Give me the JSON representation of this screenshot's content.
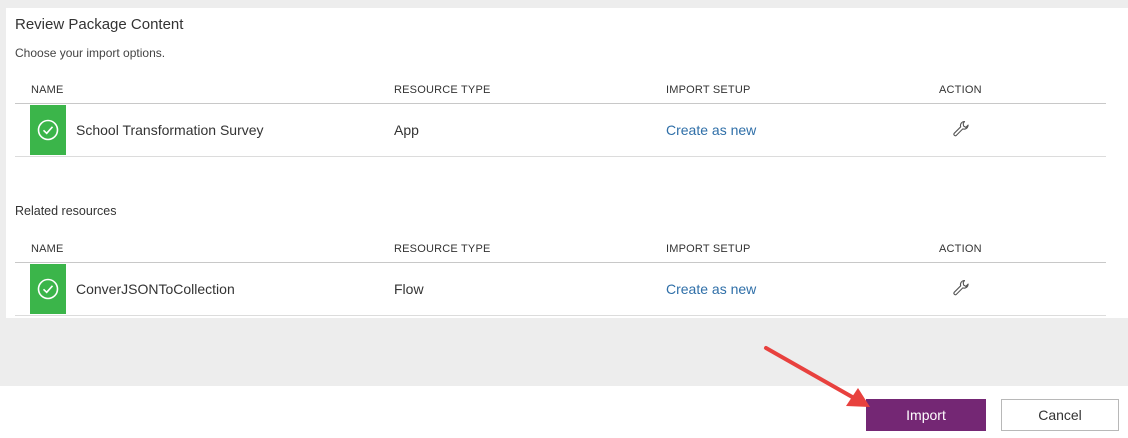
{
  "title": "Review Package Content",
  "subtitle": "Choose your import options.",
  "columns": {
    "name": "NAME",
    "resource_type": "RESOURCE TYPE",
    "import_setup": "IMPORT SETUP",
    "action": "ACTION"
  },
  "main_rows": [
    {
      "status": "ok",
      "name": "School Transformation Survey",
      "resource_type": "App",
      "import_setup": "Create as new",
      "action_icon": "wrench-icon"
    }
  ],
  "related": {
    "label": "Related resources",
    "rows": [
      {
        "status": "ok",
        "name": "ConverJSONToCollection",
        "resource_type": "Flow",
        "import_setup": "Create as new",
        "action_icon": "wrench-icon"
      }
    ]
  },
  "buttons": {
    "import": "Import",
    "cancel": "Cancel"
  },
  "colors": {
    "status_ok": "#3bb54a",
    "link": "#2f6fa8",
    "primary": "#742774",
    "annotation_arrow": "#e8413e"
  }
}
